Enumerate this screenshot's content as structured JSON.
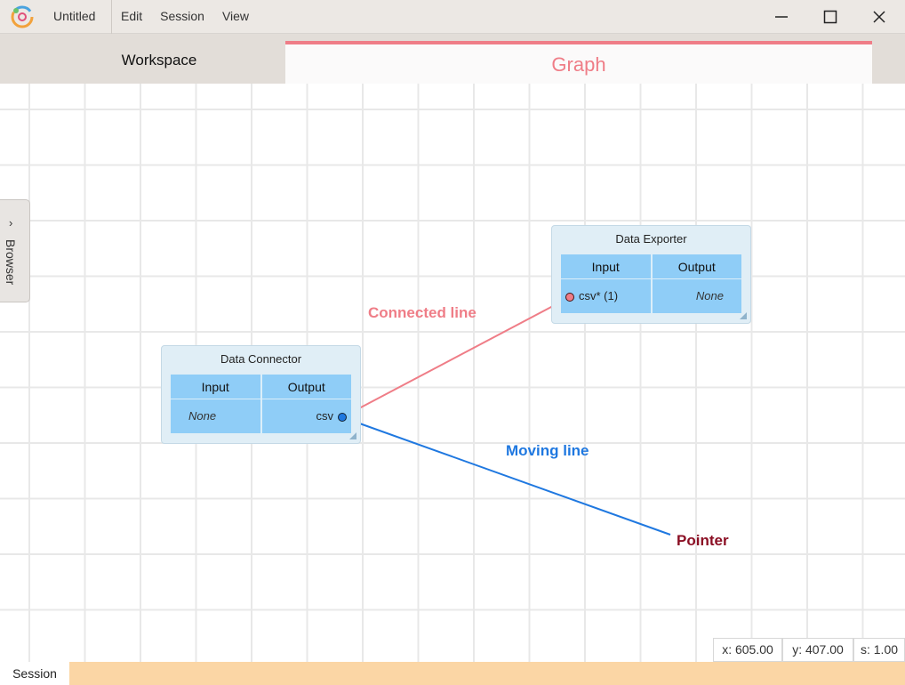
{
  "titlebar": {
    "title": "Untitled",
    "menu": [
      "Edit",
      "Session",
      "View"
    ]
  },
  "tabs": {
    "workspace": "Workspace",
    "graph": "Graph"
  },
  "browser": {
    "label": "Browser"
  },
  "nodes": {
    "connector": {
      "title": "Data Connector",
      "input_header": "Input",
      "output_header": "Output",
      "input_value": "None",
      "output_value": "csv"
    },
    "exporter": {
      "title": "Data Exporter",
      "input_header": "Input",
      "output_header": "Output",
      "input_value": "csv* (1)",
      "output_value": "None"
    }
  },
  "annotations": {
    "connected": "Connected line",
    "moving": "Moving line",
    "pointer": "Pointer"
  },
  "status": {
    "x": "x: 605.00",
    "y": "y: 407.00",
    "s": "s: 1.00",
    "session": "Session"
  },
  "colors": {
    "accent": "#ef7d87",
    "moving_line": "#1f78e0",
    "pointer_text": "#8b0f24",
    "node_bg": "#e0eef6",
    "node_table": "#8fcdf7",
    "status_bar": "#fbd6a5"
  },
  "icons": {
    "app": "app-logo-icon",
    "minimize": "minimize-icon",
    "maximize": "maximize-icon",
    "close": "close-icon",
    "chevron": "chevron-right-icon"
  }
}
